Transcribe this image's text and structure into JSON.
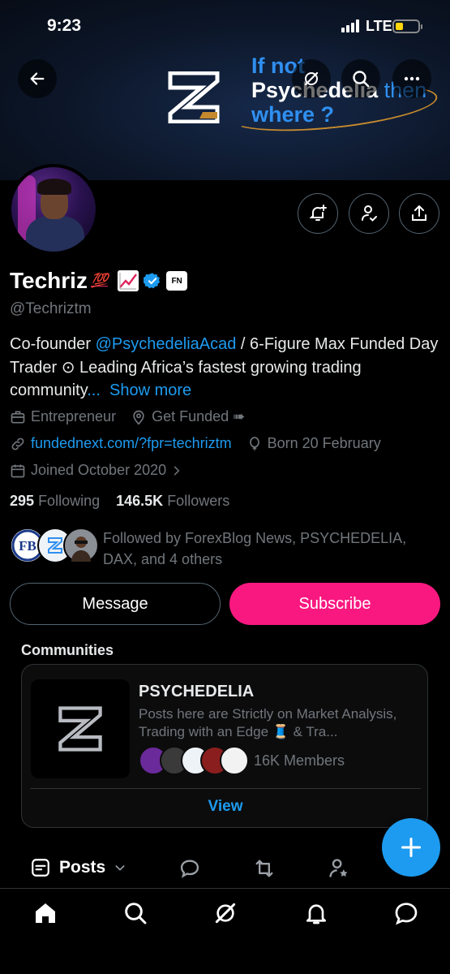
{
  "status_bar": {
    "time": "9:23",
    "network": "LTE",
    "battery_level": 0.35,
    "battery_color": "#ffd60a"
  },
  "banner": {
    "tagline_line1": "If not",
    "tagline_line2": "Psychedelia",
    "tagline_line2_suffix": "then",
    "tagline_line3": "where ?"
  },
  "profile": {
    "display_name": "Techriz",
    "name_emoji": "💯",
    "handle": "@Techriztm",
    "affiliate_badge": "FN",
    "bio_prefix": "Co-founder ",
    "bio_mention": "@PsychedeliaAcad",
    "bio_rest": " / 6-Figure Max Funded Day Trader ⊙ Leading Africa’s fastest growing trading community",
    "bio_ellipsis": "...",
    "show_more": "Show more",
    "category": "Entrepreneur",
    "location": "Get Funded ➠",
    "website": "fundednext.com/?fpr=techriztm",
    "birthday": "Born 20 February",
    "joined": "Joined October 2020",
    "following_count": "295",
    "following_label": "Following",
    "followers_count": "146.5K",
    "followers_label": "Followers",
    "followed_by": "Followed by ForexBlog News, PSYCHEDELIA, DAX, and 4 others"
  },
  "actions": {
    "message": "Message",
    "subscribe": "Subscribe"
  },
  "communities": {
    "title": "Communities",
    "name": "PSYCHEDELIA",
    "description": "Posts here are Strictly on Market Analysis, Trading with an Edge 🧵 & Tra...",
    "members": "16K Members",
    "view": "View"
  },
  "filter": {
    "posts_label": "Posts"
  },
  "colors": {
    "accent": "#1d9bf0",
    "subscribe": "#f91880",
    "muted": "#71767b"
  }
}
